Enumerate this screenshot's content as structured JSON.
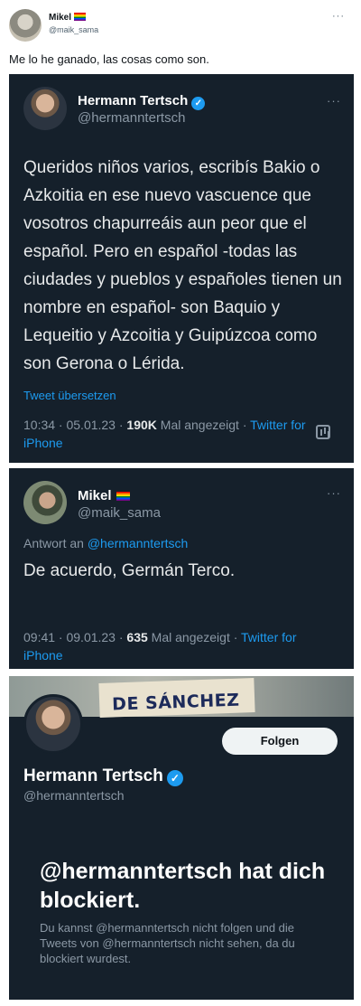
{
  "outer": {
    "name": "Mikel",
    "handle": "@maik_sama",
    "text": "Me lo he ganado, las cosas como son.",
    "more_icon": "more-dots-icon"
  },
  "quoted_tweet": {
    "name": "Hermann Tertsch",
    "handle": "@hermanntertsch",
    "text": "Queridos niños varios, escribís Bakio o Azkoitia en ese nuevo vascuence que vosotros chapurreáis aun peor que el español. Pero en español -todas las ciudades y pueblos y españoles tienen un nombre en español- son Baquio y Lequeitio y Azcoitia y Guipúzcoa como son Gerona o Lérida.",
    "translate_label": "Tweet übersetzen",
    "time": "10:34 · 05.01.23 · ",
    "views": "190K",
    "views_label": " Mal angezeigt · ",
    "source": "Twitter for iPhone"
  },
  "reply_tweet": {
    "name": "Mikel",
    "handle": "@maik_sama",
    "reply_prefix": "Antwort an ",
    "reply_to": "@hermanntertsch",
    "text": "De acuerdo, Germán Terco.",
    "time": "09:41 · 09.01.23 · ",
    "views": "635",
    "views_label": " Mal angezeigt · ",
    "source": "Twitter for iPhone"
  },
  "profile": {
    "banner_text": "DE SÁNCHEZ",
    "follow_label": "Folgen",
    "name": "Hermann Tertsch",
    "handle": "@hermanntertsch",
    "block_title": "@hermanntertsch hat dich blockiert.",
    "block_desc": "Du kannst @hermanntertsch nicht folgen und die Tweets von @hermanntertsch nicht sehen, da du blockiert wurdest."
  },
  "colors": {
    "card_bg": "#15202b",
    "link": "#1d9bf0",
    "muted": "#8b98a5"
  }
}
